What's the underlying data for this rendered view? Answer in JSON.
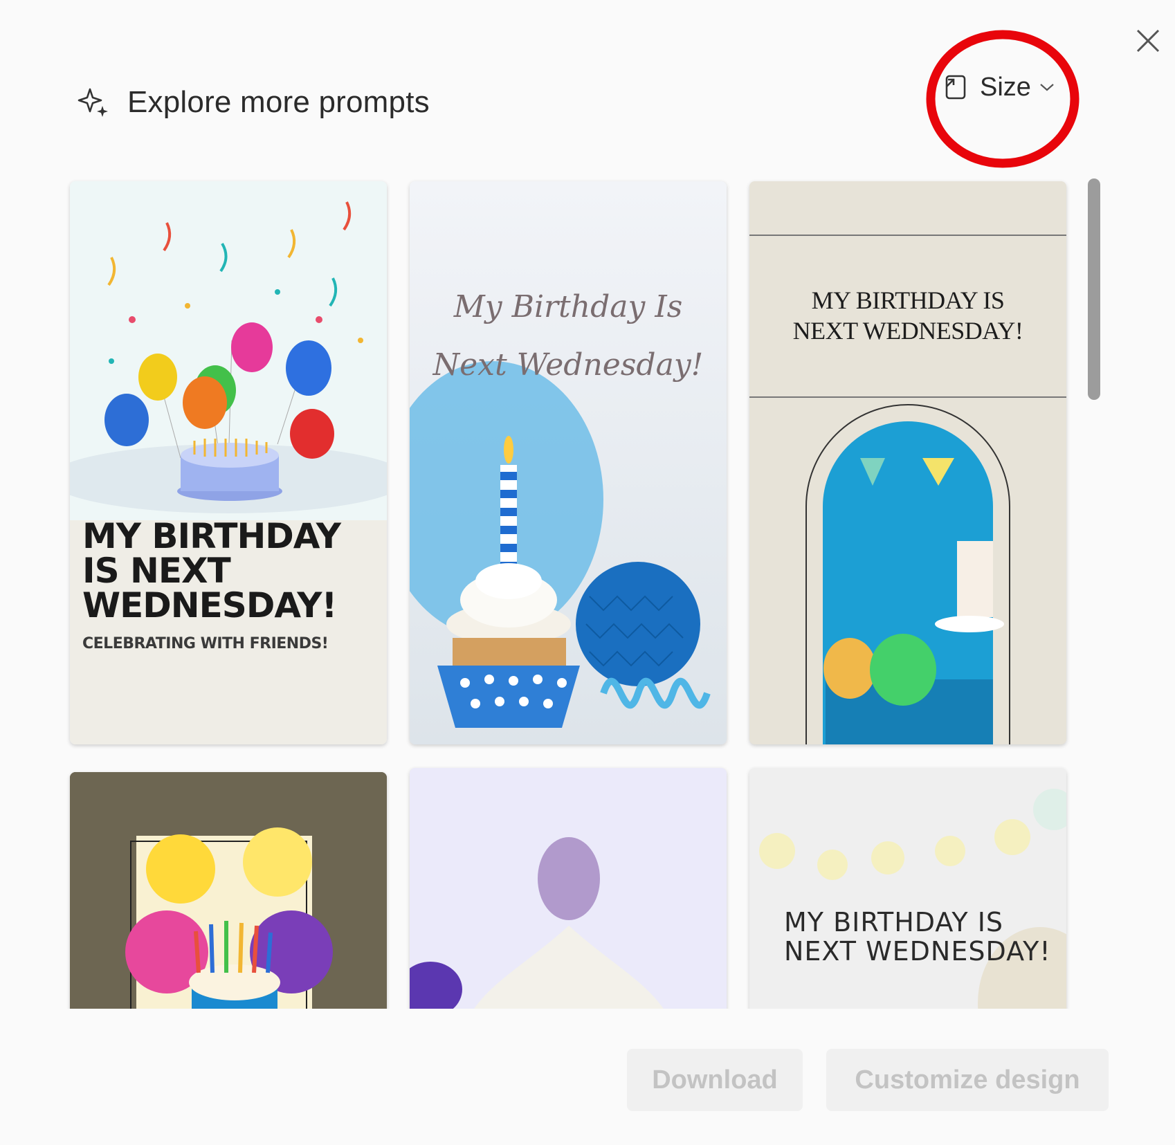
{
  "dialog": {
    "title": "Explore more prompts",
    "title_icon": "sparkle-icon",
    "close_icon": "close-icon",
    "size_button": {
      "label": "Size",
      "icon": "resize-icon",
      "chevron": "chevron-down-icon"
    },
    "annotation": {
      "shape": "circle",
      "color": "#e8050b",
      "target": "size-button"
    }
  },
  "templates": [
    {
      "heading": "MY BIRTHDAY IS NEXT WEDNESDAY!",
      "subheading": "CELEBRATING WITH FRIENDS!"
    },
    {
      "heading": "My Birthday Is Next Wednesday!"
    },
    {
      "heading_line1": "MY BIRTHDAY IS",
      "heading_line2": "NEXT WEDNESDAY!"
    },
    {
      "heading": ""
    },
    {
      "heading": ""
    },
    {
      "heading": "MY BIRTHDAY IS NEXT WEDNESDAY!"
    }
  ],
  "footer": {
    "download_label": "Download",
    "customize_label": "Customize design"
  },
  "colors": {
    "background": "#fafafa",
    "button_disabled_bg": "#f0f0f0",
    "button_disabled_text": "#c3c3c3",
    "annotation": "#e8050b"
  }
}
